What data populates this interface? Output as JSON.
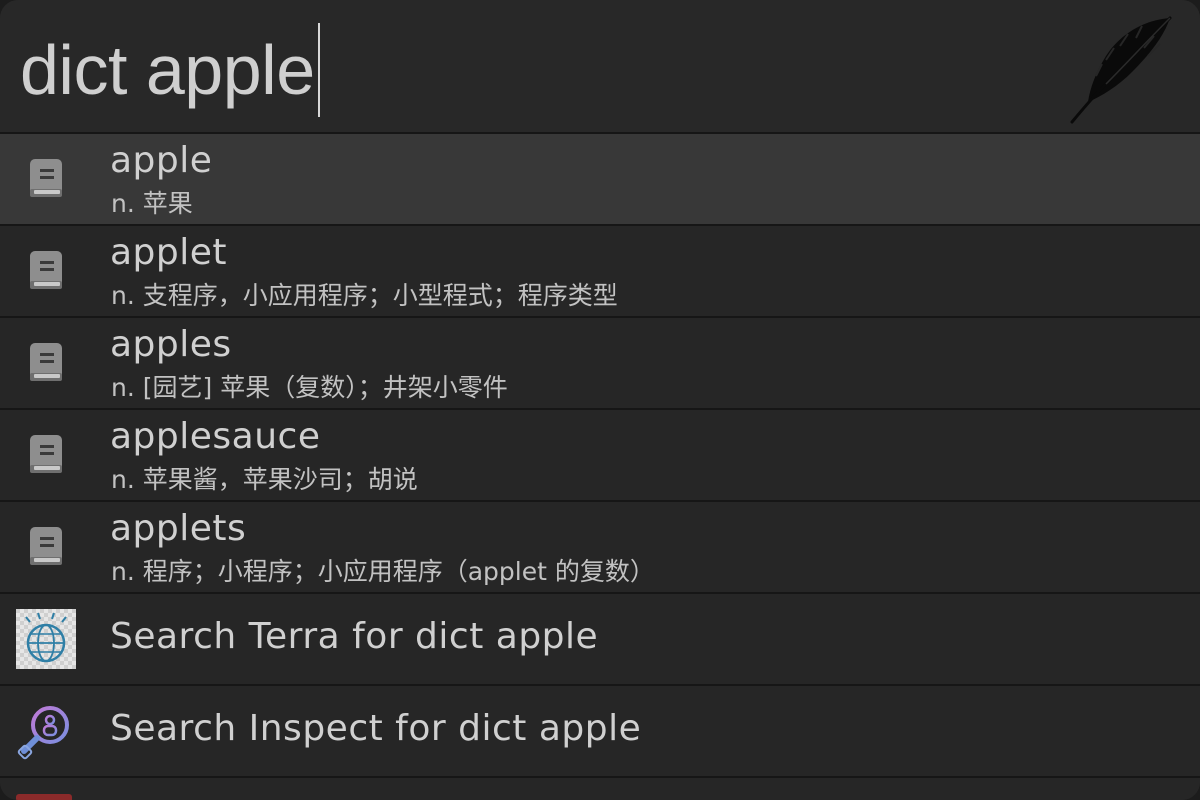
{
  "search": {
    "query": "dict apple"
  },
  "results": [
    {
      "title": "apple",
      "subtitle": "n. 苹果",
      "icon": "dictionary-book-icon"
    },
    {
      "title": "applet",
      "subtitle": "n. 支程序，小应用程序；小型程式；程序类型",
      "icon": "dictionary-book-icon"
    },
    {
      "title": "apples",
      "subtitle": "n. [园艺] 苹果（复数）；井架小零件",
      "icon": "dictionary-book-icon"
    },
    {
      "title": "applesauce",
      "subtitle": "n. 苹果酱，苹果沙司；胡说",
      "icon": "dictionary-book-icon"
    },
    {
      "title": "applets",
      "subtitle": "n. 程序；小程序；小应用程序（applet 的复数）",
      "icon": "dictionary-book-icon"
    }
  ],
  "web_searches": [
    {
      "title": "Search Terra for dict apple",
      "icon": "terra-globe-icon"
    },
    {
      "title": "Search Inspect for dict apple",
      "icon": "inspect-magnifier-icon"
    }
  ],
  "colors": {
    "background": "#262626",
    "selected_row": "#383838",
    "text": "#d0d0d0",
    "divider": "#161616"
  }
}
